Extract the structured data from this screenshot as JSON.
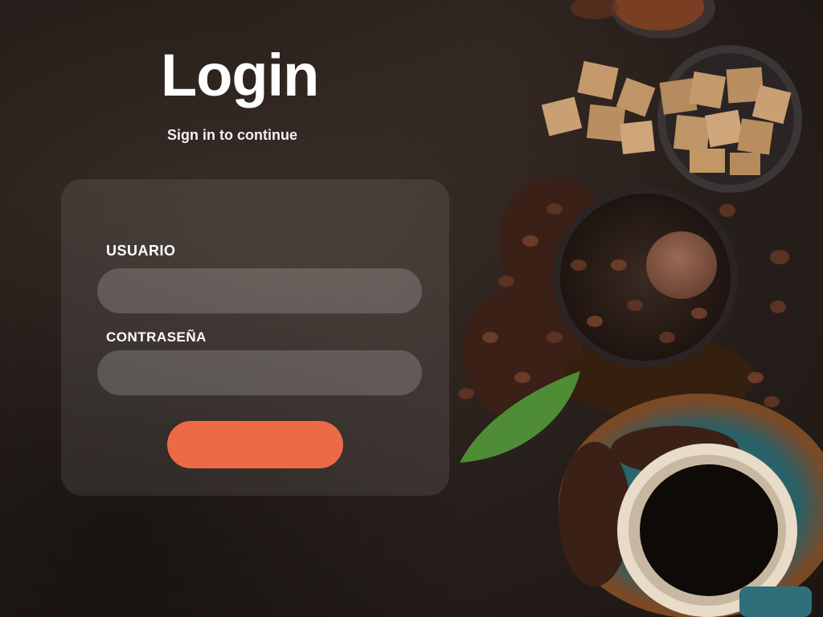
{
  "login": {
    "title": "Login",
    "subtitle": "Sign in to continue",
    "username_label": "USUARIO",
    "username_value": "",
    "password_label": "CONTRASEÑA",
    "password_value": "",
    "submit_label": ""
  },
  "colors": {
    "background": "#2a211d",
    "card": "rgba(255,255,255,0.09)",
    "field": "rgba(255,255,255,0.18)",
    "button": "#ec6a46",
    "text": "#ffffff"
  },
  "decor": {
    "image_subject": "coffee-beans-sugar-cup-illustration"
  }
}
